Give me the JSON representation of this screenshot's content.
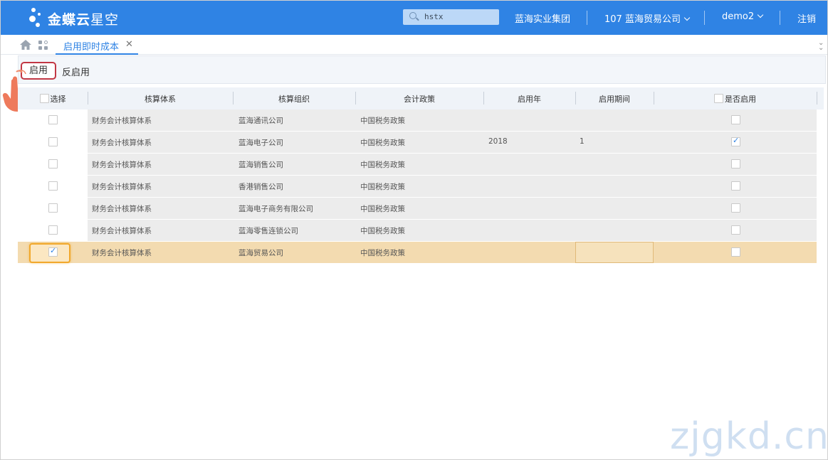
{
  "brand": {
    "name": "金蝶云",
    "product": "星空"
  },
  "colors": {
    "topbar": "#2f83e4",
    "accent": "#2f83e4",
    "highlight_row": "#f3dbb0",
    "enable_button_border": "#c23744"
  },
  "search": {
    "value": "hstx",
    "icon": "search-icon"
  },
  "topbar": {
    "group": "蓝海实业集团",
    "company": "107 蓝海贸易公司",
    "user": "demo2",
    "logout": "注销"
  },
  "tabs": [
    {
      "label": "启用即时成本",
      "active": true
    }
  ],
  "toolbar": {
    "enable_label": "启用",
    "disable_label": "反启用"
  },
  "table": {
    "columns": [
      "选择",
      "核算体系",
      "核算组织",
      "会计政策",
      "启用年",
      "启用期间",
      "是否启用"
    ],
    "rows": [
      {
        "selected": false,
        "system": "财务会计核算体系",
        "org": "蓝海通讯公司",
        "policy": "中国税务政策",
        "year": "",
        "period": "",
        "enabled": false
      },
      {
        "selected": false,
        "system": "财务会计核算体系",
        "org": "蓝海电子公司",
        "policy": "中国税务政策",
        "year": "2018",
        "period": "1",
        "enabled": true
      },
      {
        "selected": false,
        "system": "财务会计核算体系",
        "org": "蓝海销售公司",
        "policy": "中国税务政策",
        "year": "",
        "period": "",
        "enabled": false
      },
      {
        "selected": false,
        "system": "财务会计核算体系",
        "org": "香港销售公司",
        "policy": "中国税务政策",
        "year": "",
        "period": "",
        "enabled": false
      },
      {
        "selected": false,
        "system": "财务会计核算体系",
        "org": "蓝海电子商务有限公司",
        "policy": "中国税务政策",
        "year": "",
        "period": "",
        "enabled": false
      },
      {
        "selected": false,
        "system": "财务会计核算体系",
        "org": "蓝海零售连锁公司",
        "policy": "中国税务政策",
        "year": "",
        "period": "",
        "enabled": false
      },
      {
        "selected": true,
        "system": "财务会计核算体系",
        "org": "蓝海贸易公司",
        "policy": "中国税务政策",
        "year": "",
        "period": "",
        "enabled": false
      }
    ]
  },
  "watermark": "zjgkd.cn"
}
